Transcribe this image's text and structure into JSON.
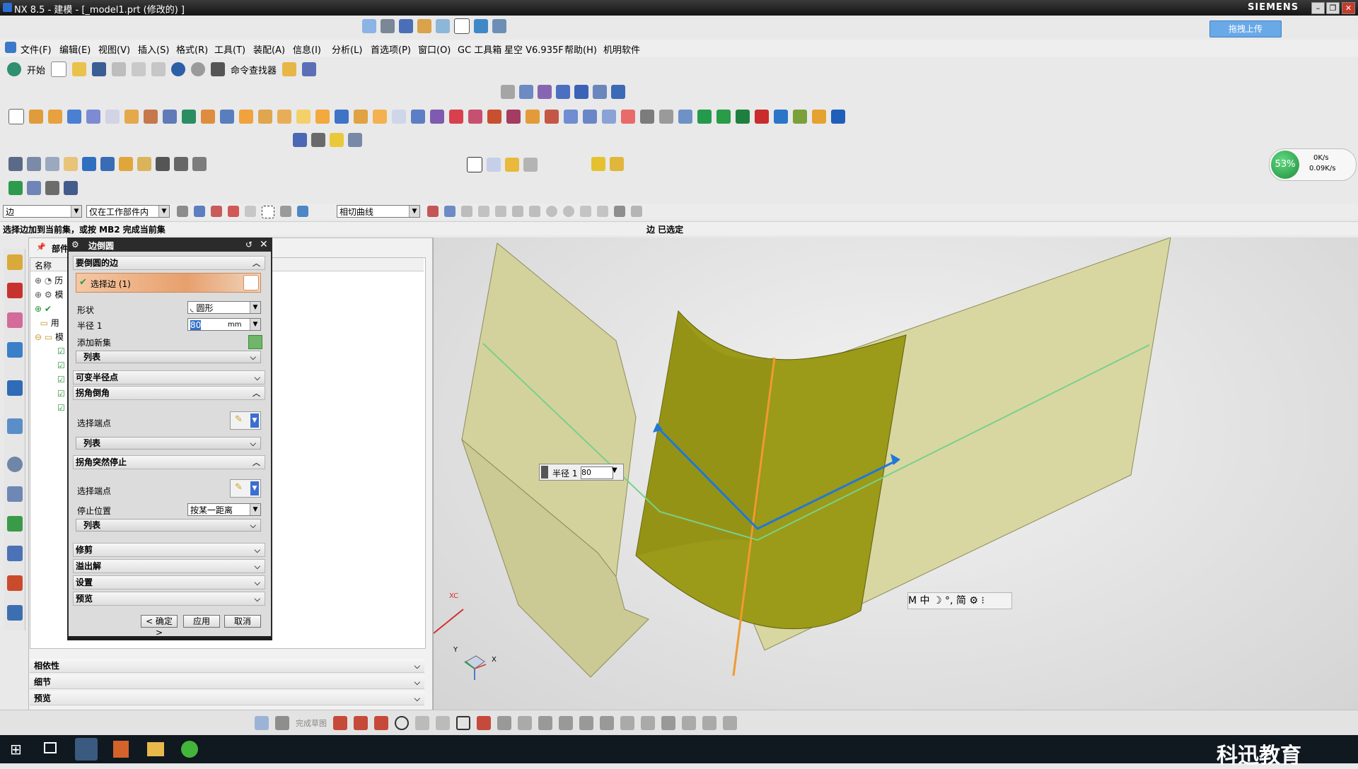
{
  "window": {
    "title": "NX 8.5 - 建模 - [_model1.prt  (修改的) ]",
    "brand": "SIEMENS",
    "min": "–",
    "restore": "❐",
    "close": "✕"
  },
  "cloud_upload": "拖拽上传",
  "menu": [
    "文件(F)",
    "编辑(E)",
    "视图(V)",
    "插入(S)",
    "格式(R)",
    "工具(T)",
    "装配(A)",
    "信息(I)",
    "分析(L)",
    "首选项(P)",
    "窗口(O)",
    "GC 工具箱",
    "星空 V6.935F",
    "帮助(H)",
    "机明软件"
  ],
  "toolbar": {
    "start": "开始",
    "command_finder": "命令查找器"
  },
  "selection_bar": {
    "type_filter": "边",
    "scope": "仅在工作部件内",
    "curve_rule": "相切曲线"
  },
  "status": {
    "prompt": "选择边加到当前集，或按 MB2 完成当前集",
    "selected": "边 已选定"
  },
  "navigator": {
    "title": "部件",
    "col_name": "名称",
    "rows": [
      "历",
      "模",
      "",
      "用",
      "模"
    ],
    "sections": [
      "相依性",
      "细节",
      "预览"
    ]
  },
  "dialog": {
    "title": "边倒圆",
    "sec_edges": "要倒圆的边",
    "select_edge": "选择边 (1)",
    "shape_label": "形状",
    "shape_value": "圆形",
    "radius_label": "半径 1",
    "radius_value": "80",
    "radius_unit": "mm",
    "add_set": "添加新集",
    "list": "列表",
    "sec_variable": "可变半径点",
    "sec_corner_setback": "拐角倒角",
    "select_end_point": "选择端点",
    "sec_corner_stop": "拐角突然停止",
    "stop_position_label": "停止位置",
    "stop_position_value": "按某一距离",
    "sec_trim": "修剪",
    "sec_overflow": "溢出解",
    "sec_settings": "设置",
    "sec_preview": "预览",
    "ok": "< 确定 >",
    "apply": "应用",
    "cancel": "取消"
  },
  "viewport": {
    "radius_popup_label": "半径 1",
    "radius_popup_value": "80",
    "triad_x": "X",
    "triad_y": "Y",
    "wcs_x": "XC",
    "mini_bar": "M 中 ☽ °, 简 ⚙ ⁝"
  },
  "net_widget": {
    "percent": "53%",
    "up": "0K/s",
    "down": "0.09K/s"
  },
  "sketch_bar": {
    "finish_sketch": "完成草图"
  },
  "watermark": "科迅教育",
  "colors": {
    "fillet_face": "#9a9a16",
    "wall_face": "#d6d5a0",
    "edge_blue": "#1f78d8",
    "edge_orange": "#f09a30",
    "edge_green": "#7ad08a"
  }
}
